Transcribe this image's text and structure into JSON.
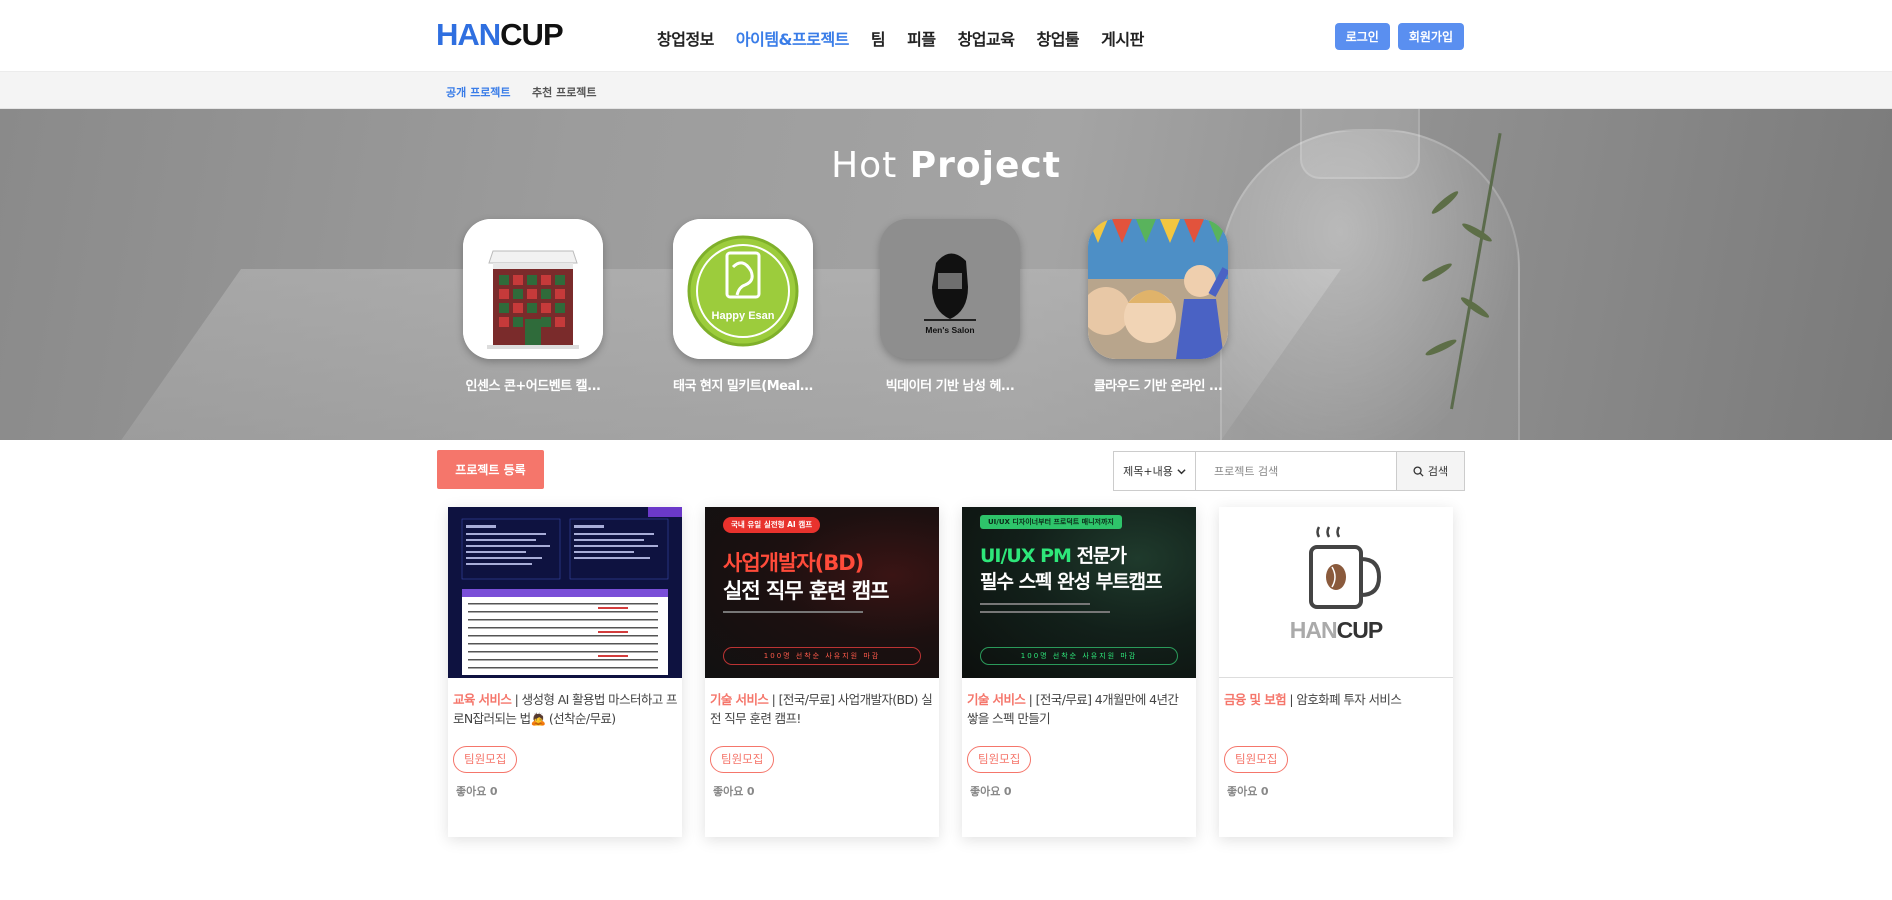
{
  "header": {
    "logo_han": "HAN",
    "logo_cup": "CUP",
    "nav": [
      "창업정보",
      "아이템&프로젝트",
      "팀",
      "피플",
      "창업교육",
      "창업툴",
      "게시판"
    ],
    "nav_active_index": 1,
    "login": "로그인",
    "signup": "회원가입"
  },
  "subnav": {
    "items": [
      "공개 프로젝트",
      "추천 프로젝트"
    ]
  },
  "hero": {
    "title_light": "Hot",
    "title_bold": "Project",
    "items": [
      {
        "name": "인센스 콘+어드벤트 캘...",
        "icon": "advent-house-icon"
      },
      {
        "name": "태국 현지 밀키트(Meal...",
        "icon": "happy-esan-logo-icon",
        "logo_text": "Happy Esan"
      },
      {
        "name": "빅데이터 기반 남성 헤...",
        "icon": "mens-salon-logo-icon",
        "logo_text": "Men's Salon"
      },
      {
        "name": "클라우드 기반 온라인 ...",
        "icon": "birthday-kids-photo-icon"
      }
    ]
  },
  "toolbar": {
    "register": "프로젝트 등록",
    "search_select": "제목+내용",
    "search_placeholder": "프로젝트 검색",
    "search_button": "검색"
  },
  "cards": [
    {
      "category": "교육 서비스",
      "title": "생성형 AI 활용법 마스터하고 프로N잡러되는 법🙇 (선착순/무료)",
      "tag": "팀원모집",
      "likes_label": "좋아요",
      "likes": "0"
    },
    {
      "category": "기술 서비스",
      "title": "[전국/무료] 사업개발자(BD) 실전 직무 훈련 캠프!",
      "tag": "팀원모집",
      "likes_label": "좋아요",
      "likes": "0",
      "img_badge": "국내 유일 실전형 AI 캠프",
      "img_line1_a": "사업개발자(BD)",
      "img_line2": "실전 직무 훈련 캠프",
      "img_foot": "100명 선착순 사유지원 마감"
    },
    {
      "category": "기술 서비스",
      "title": "[전국/무료] 4개월만에 4년간 쌓을 스펙 만들기",
      "tag": "팀원모집",
      "likes_label": "좋아요",
      "likes": "0",
      "img_badge": "UI/UX 디자이너부터 프로덕트 매니저까지",
      "img_line1_a": "UI/UX PM ",
      "img_line1_b": "전문가",
      "img_line2": "필수 스펙 완성 부트캠프",
      "img_foot": "100명 선착순 사유지원 마감"
    },
    {
      "category": "금융 및 보험",
      "title": "암호화폐 투자 서비스",
      "tag": "팀원모집",
      "likes_label": "좋아요",
      "likes": "0",
      "img_logo_han": "HAN",
      "img_logo_cup": "CUP"
    }
  ],
  "colors": {
    "brand_blue": "#2f6fe0",
    "accent_coral": "#f5766b",
    "button_blue": "#5a8ff0"
  }
}
